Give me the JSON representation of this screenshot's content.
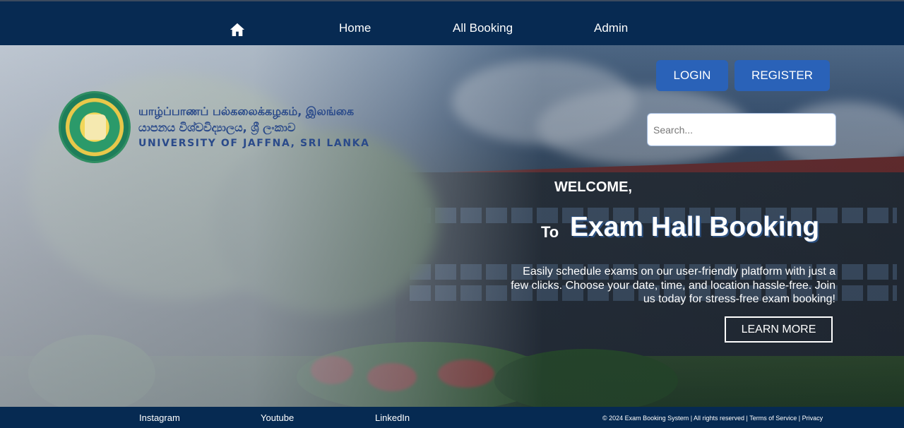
{
  "nav": {
    "home_icon": "home-icon",
    "items": [
      {
        "label": "Home"
      },
      {
        "label": "All Booking"
      },
      {
        "label": "Admin"
      }
    ]
  },
  "logo": {
    "line1": "யாழ்ப்பாணப் பல்கலைக்கழகம், இலங்கை",
    "line2": "යාපනය විශ්වවිද්‍යාලය, ශ්‍රී ලංකාව",
    "line3": "UNIVERSITY OF JAFFNA, SRI LANKA"
  },
  "auth": {
    "login_label": "LOGIN",
    "register_label": "REGISTER"
  },
  "search": {
    "placeholder": "Search...",
    "value": ""
  },
  "hero": {
    "welcome": "WELCOME,",
    "to": "To",
    "title": "Exam Hall Booking",
    "description": "Easily schedule exams on our user-friendly platform with just a few clicks. Choose your date, time, and location hassle-free. Join us today for stress-free exam booking!",
    "cta_label": "LEARN MORE"
  },
  "footer": {
    "links": [
      {
        "label": "Instagram"
      },
      {
        "label": "Youtube"
      },
      {
        "label": "LinkedIn"
      }
    ],
    "copyright": "© 2024 Exam Booking System | All rights reserved | Terms of Service | Privacy"
  },
  "colors": {
    "nav_bg": "#072a52",
    "button_bg": "#2a62b8",
    "footer_bg": "#062a52",
    "title_shadow": "#2b4f7f"
  }
}
